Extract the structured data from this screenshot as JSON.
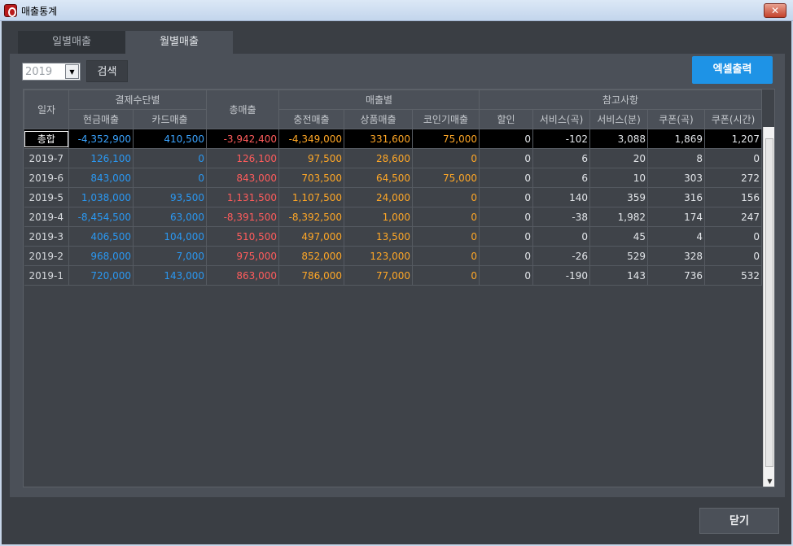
{
  "window": {
    "title": "매출통계",
    "close_glyph": "✕"
  },
  "tabs": [
    {
      "label": "일별매출"
    },
    {
      "label": "월별매출"
    }
  ],
  "toolbar": {
    "year_value": "2019",
    "year_arrow": "▼",
    "search_label": "검색",
    "excel_label": "엑셀출력"
  },
  "table": {
    "headers": {
      "date": "일자",
      "payment_group": "결제수단별",
      "cash": "현금매출",
      "card": "카드매출",
      "total": "총매출",
      "sales_group": "매출별",
      "charge": "충전매출",
      "product": "상품매출",
      "coin": "코인기매출",
      "ref_group": "참고사항",
      "discount": "할인",
      "service_song": "서비스(곡)",
      "service_min": "서비스(분)",
      "coupon_song": "쿠폰(곡)",
      "coupon_time": "쿠폰(시간)"
    },
    "total_row": {
      "label": "총합",
      "cash": "-4,352,900",
      "card": "410,500",
      "total": "-3,942,400",
      "charge": "-4,349,000",
      "product": "331,600",
      "coin": "75,000",
      "discount": "0",
      "service_song": "-102",
      "service_min": "3,088",
      "coupon_song": "1,869",
      "coupon_time": "1,207"
    },
    "rows": [
      {
        "date": "2019-7",
        "cash": "126,100",
        "card": "0",
        "total": "126,100",
        "charge": "97,500",
        "product": "28,600",
        "coin": "0",
        "discount": "0",
        "service_song": "6",
        "service_min": "20",
        "coupon_song": "8",
        "coupon_time": "0"
      },
      {
        "date": "2019-6",
        "cash": "843,000",
        "card": "0",
        "total": "843,000",
        "charge": "703,500",
        "product": "64,500",
        "coin": "75,000",
        "discount": "0",
        "service_song": "6",
        "service_min": "10",
        "coupon_song": "303",
        "coupon_time": "272"
      },
      {
        "date": "2019-5",
        "cash": "1,038,000",
        "card": "93,500",
        "total": "1,131,500",
        "charge": "1,107,500",
        "product": "24,000",
        "coin": "0",
        "discount": "0",
        "service_song": "140",
        "service_min": "359",
        "coupon_song": "316",
        "coupon_time": "156"
      },
      {
        "date": "2019-4",
        "cash": "-8,454,500",
        "card": "63,000",
        "total": "-8,391,500",
        "charge": "-8,392,500",
        "product": "1,000",
        "coin": "0",
        "discount": "0",
        "service_song": "-38",
        "service_min": "1,982",
        "coupon_song": "174",
        "coupon_time": "247"
      },
      {
        "date": "2019-3",
        "cash": "406,500",
        "card": "104,000",
        "total": "510,500",
        "charge": "497,000",
        "product": "13,500",
        "coin": "0",
        "discount": "0",
        "service_song": "0",
        "service_min": "45",
        "coupon_song": "4",
        "coupon_time": "0"
      },
      {
        "date": "2019-2",
        "cash": "968,000",
        "card": "7,000",
        "total": "975,000",
        "charge": "852,000",
        "product": "123,000",
        "coin": "0",
        "discount": "0",
        "service_song": "-26",
        "service_min": "529",
        "coupon_song": "328",
        "coupon_time": "0"
      },
      {
        "date": "2019-1",
        "cash": "720,000",
        "card": "143,000",
        "total": "863,000",
        "charge": "786,000",
        "product": "77,000",
        "coin": "0",
        "discount": "0",
        "service_song": "-190",
        "service_min": "143",
        "coupon_song": "736",
        "coupon_time": "532"
      }
    ]
  },
  "footer": {
    "close_label": "닫기"
  },
  "colors": {
    "cash_card": "#2a98f2",
    "total": "#ff5c5c",
    "sales": "#ffa726",
    "accent_button": "#1e93e6"
  },
  "icons": {
    "app": "app-logo-icon",
    "close": "close-icon",
    "dropdown": "chevron-down-icon"
  }
}
